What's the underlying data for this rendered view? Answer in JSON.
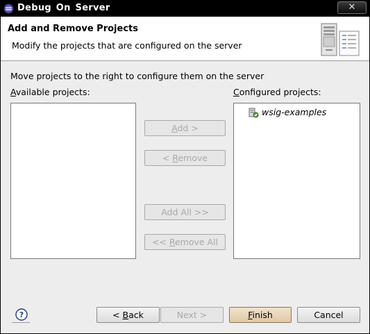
{
  "window": {
    "title": "Debug  On  Server",
    "close_label": "✕"
  },
  "header": {
    "title": "Add and Remove Projects",
    "description": "Modify the projects that are configured on the server"
  },
  "body": {
    "instruction": "Move projects to the right to configure them on the server",
    "available_label_mnemonic": "A",
    "available_label_rest": "vailable projects:",
    "configured_label_mnemonic": "C",
    "configured_label_rest": "onfigured projects:"
  },
  "available_projects": [],
  "configured_projects": [
    {
      "label": "wsig-examples",
      "icon": "server-project-icon"
    }
  ],
  "middle_buttons": {
    "add_mnemonic": "A",
    "add_rest": "dd >",
    "remove_prefix": "< ",
    "remove_mnemonic": "R",
    "remove_rest": "emove",
    "add_all": "Add All >>",
    "remove_all_prefix": "<< ",
    "remove_all_mnemonic": "R",
    "remove_all_rest": "emove All"
  },
  "footer": {
    "help_icon": "help-icon",
    "back_prefix": "< ",
    "back_mnemonic": "B",
    "back_rest": "ack",
    "next": "Next >",
    "finish_mnemonic": "F",
    "finish_rest": "inish",
    "cancel": "Cancel"
  }
}
